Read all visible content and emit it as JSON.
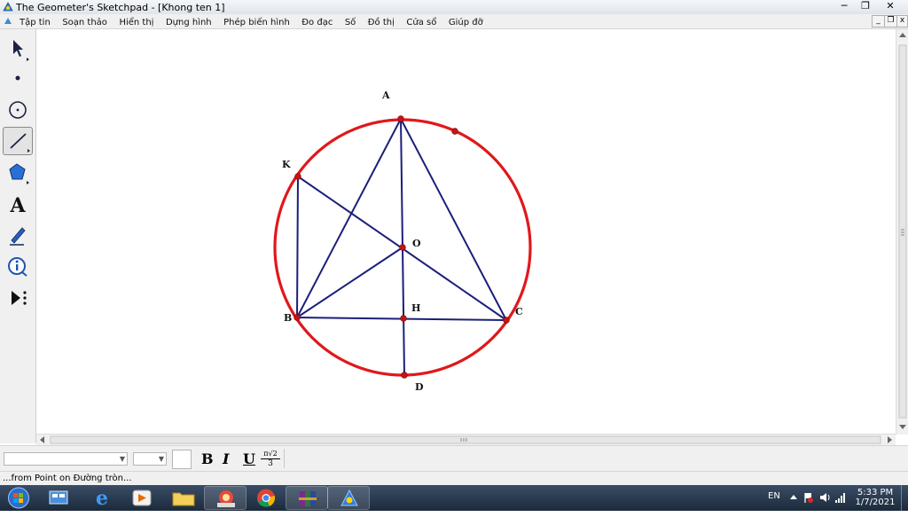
{
  "window": {
    "title": "The Geometer's Sketchpad - [Khong ten 1]",
    "min_glyph": "─",
    "max_glyph": "❐",
    "close_glyph": "✕"
  },
  "menubar": {
    "items": [
      "Tập tin",
      "Soạn thảo",
      "Hiển thị",
      "Dựng hình",
      "Phép biến hình",
      "Đo đạc",
      "Số",
      "Đồ thị",
      "Cửa sổ",
      "Giúp đỡ"
    ],
    "doc_min": "_",
    "doc_restore": "❐",
    "doc_close": "x"
  },
  "toolbox": {
    "tools": [
      {
        "name": "arrow-tool",
        "icon": "arrow-icon",
        "active": false
      },
      {
        "name": "point-tool",
        "icon": "point-icon",
        "active": false
      },
      {
        "name": "compass-tool",
        "icon": "compass-icon",
        "active": false
      },
      {
        "name": "straightedge-tool",
        "icon": "segment-icon",
        "active": true
      },
      {
        "name": "polygon-tool",
        "icon": "polygon-icon",
        "active": false
      },
      {
        "name": "text-tool",
        "icon": "text-icon",
        "active": false
      },
      {
        "name": "marker-tool",
        "icon": "marker-icon",
        "active": false
      },
      {
        "name": "information-tool",
        "icon": "info-icon",
        "active": false
      },
      {
        "name": "custom-tool",
        "icon": "custom-tool-icon",
        "active": false
      }
    ],
    "text_glyph": "A"
  },
  "sketch": {
    "circle_color": "#e0181b",
    "segment_color": "#1b1f7a",
    "point_color": "#c41414",
    "points": {
      "A": {
        "label": "A"
      },
      "K": {
        "label": "K"
      },
      "O": {
        "label": "O"
      },
      "B": {
        "label": "B"
      },
      "H": {
        "label": "H"
      },
      "C": {
        "label": "C"
      },
      "D": {
        "label": "D"
      }
    }
  },
  "textbar": {
    "bold": "B",
    "italic": "I",
    "underline": "U",
    "math_top": "π√2",
    "math_bottom": "3"
  },
  "statusbar": {
    "text": "...from Point on Đường tròn..."
  },
  "taskbar": {
    "apps": [
      "start-orb",
      "sketchpad-app",
      "internet-explorer",
      "media-player",
      "file-explorer",
      "paint-app",
      "chrome-browser",
      "winrar-app",
      "geometers-sketchpad"
    ],
    "language": "EN",
    "time": "5:33 PM",
    "date": "1/7/2021"
  }
}
